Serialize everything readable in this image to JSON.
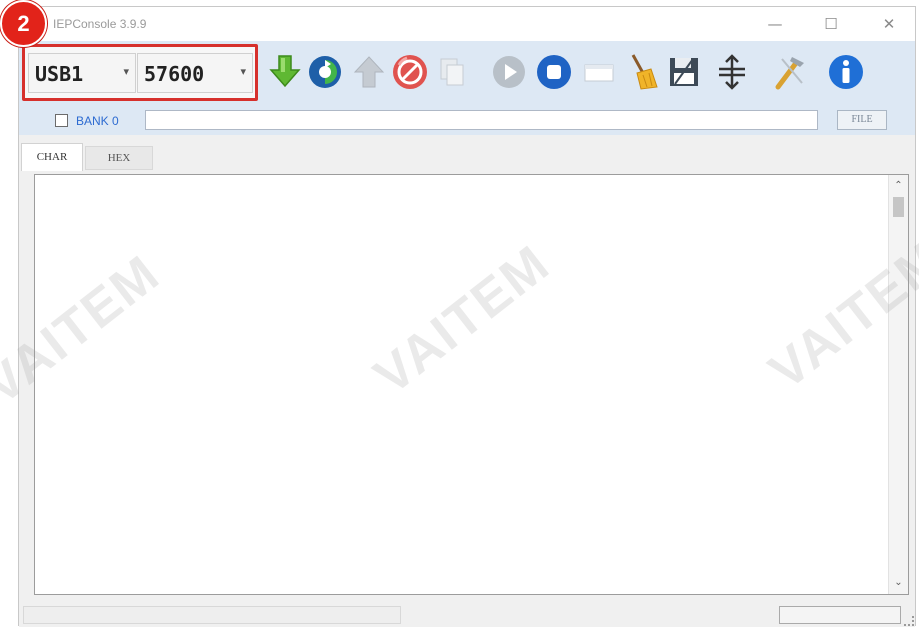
{
  "window": {
    "title": "IEPConsole 3.9.9",
    "minimize": "—",
    "maximize": "☐",
    "close": "✕"
  },
  "annotation": {
    "step_number": "2"
  },
  "toolbar": {
    "port": {
      "value": "USB1",
      "arrow": "▾"
    },
    "baud": {
      "value": "57600",
      "arrow": "▾"
    },
    "icons": [
      "download-arrow-icon",
      "refresh-icon",
      "upload-arrow-icon",
      "stop-icon",
      "copy-icon",
      "play-icon",
      "stop-square-icon",
      "blank-page-icon",
      "broom-icon",
      "save-icon",
      "resize-vertical-icon",
      "tools-icon",
      "info-icon"
    ]
  },
  "bank": {
    "label": "BANK 0",
    "checked": false,
    "input_value": "",
    "file_button": "FILE"
  },
  "tabs": [
    {
      "label": "CHAR",
      "active": true
    },
    {
      "label": "HEX",
      "active": false
    }
  ],
  "content": {
    "text": ""
  },
  "scrollbar": {
    "up": "⌃",
    "down": "⌄"
  },
  "watermark": "VAITEM",
  "colors": {
    "toolbar_bg": "#dde8f4",
    "highlight_red": "#d6302c",
    "badge_red": "#e2231a",
    "link_blue": "#2d6bd1"
  }
}
